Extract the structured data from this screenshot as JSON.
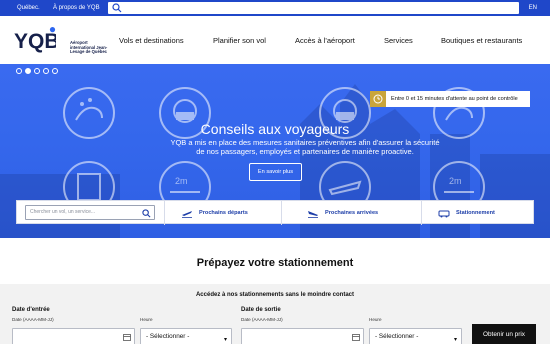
{
  "topbar": {
    "link_city": "Québec.",
    "link_about": "À propos de YQB",
    "search_placeholder": "",
    "lang": "EN"
  },
  "header": {
    "logo_mark": "YQB",
    "logo_text": "Aéroport international Jean-Lesage de Québec",
    "nav": [
      "Vols et destinations",
      "Planifier son vol",
      "Accès à l'aéroport",
      "Services",
      "Boutiques et restaurants"
    ]
  },
  "hero": {
    "slides_count": 5,
    "active_slide": 2,
    "wait_notice": "Entre 0 et 15 minutes d'attente au point de contrôle",
    "title": "Conseils aux voyageurs",
    "subtitle": "YQB a mis en place des mesures sanitaires préventives afin d'assurer la sécurité de nos passagers, employés et partenaires de manière proactive.",
    "cta": "En savoir plus"
  },
  "quickbar": {
    "search_placeholder": "Chercher un vol, un service...",
    "departures": "Prochains départs",
    "arrivals": "Prochaines arrivées",
    "parking": "Stationnement"
  },
  "parking": {
    "title": "Prépayez votre stationnement",
    "subtitle": "Accédez à nos stationnements sans le moindre contact",
    "entry_label": "Date d'entrée",
    "entry_format": "Date (AAAA-MM-JJ)",
    "entry_hour_label": "Heure",
    "entry_hour_value": "- Sélectionner -",
    "exit_label": "Date de sortie",
    "exit_format": "Date (AAAA-MM-JJ)",
    "exit_hour_label": "Heure",
    "exit_hour_value": "- Sélectionner -",
    "submit": "Obtenir un prix"
  },
  "colors": {
    "brand_blue": "#1f47c9",
    "hero_blue": "#3467ec",
    "link_blue": "#1d3ea8",
    "gold": "#c9a53b"
  }
}
